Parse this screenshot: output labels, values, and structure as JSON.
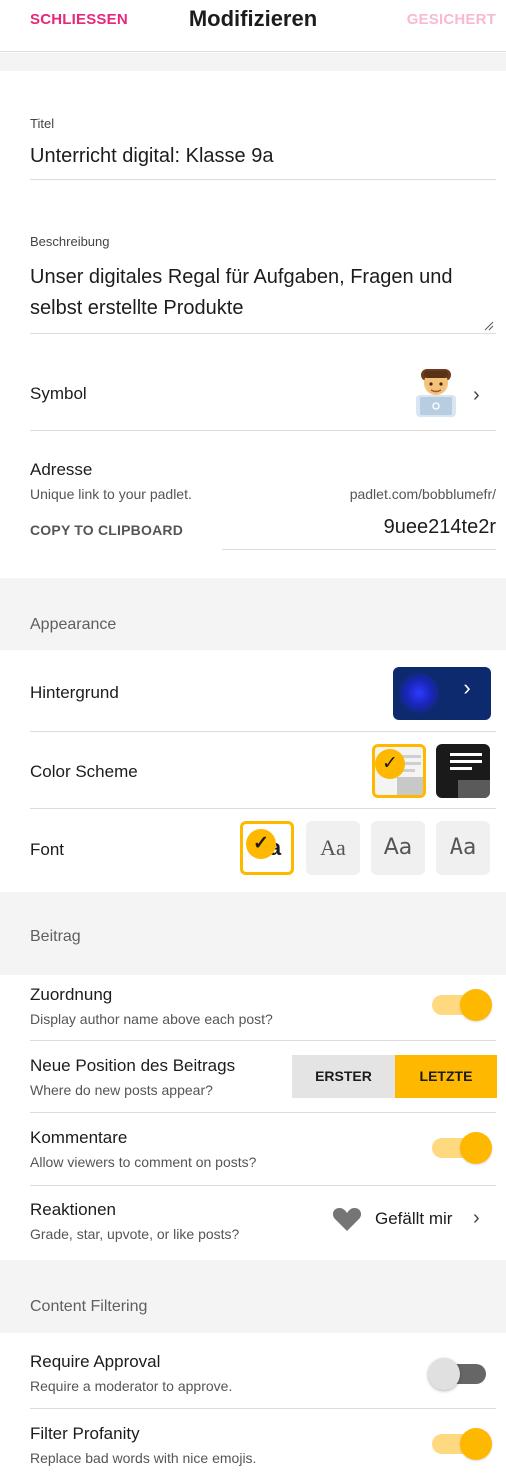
{
  "header": {
    "close_label": "SCHLIESSEN",
    "title": "Modifizieren",
    "save_label": "GESICHERT"
  },
  "form": {
    "title_label": "Titel",
    "title_value": "Unterricht digital: Klasse 9a",
    "description_label": "Beschreibung",
    "description_line1": "Unser digitales Regal für Aufgaben, Fragen und",
    "description_line2": "selbst erstellte Produkte",
    "symbol_label": "Symbol",
    "address_label": "Adresse",
    "address_hint": "Unique link to your padlet.",
    "address_base": "padlet.com/bobblumefr/",
    "copy_label": "COPY TO CLIPBOARD",
    "address_slug": "9uee214te2r"
  },
  "appearance": {
    "section_label": "Appearance",
    "background_label": "Hintergrund",
    "color_scheme_label": "Color Scheme",
    "font_label": "Font",
    "fonts": [
      "Aa",
      "Aa",
      "Aa",
      "Aa"
    ]
  },
  "post": {
    "section_label": "Beitrag",
    "attribution_label": "Zuordnung",
    "attribution_desc": "Display author name above each post?",
    "attribution_on": true,
    "position_label": "Neue Position des Beitrags",
    "position_desc": "Where do new posts appear?",
    "position_first": "ERSTER",
    "position_last": "LETZTE",
    "comments_label": "Kommentare",
    "comments_desc": "Allow viewers to comment on posts?",
    "comments_on": true,
    "reactions_label": "Reaktionen",
    "reactions_desc": "Grade, star, upvote, or like posts?",
    "reactions_value": "Gefällt mir"
  },
  "filtering": {
    "section_label": "Content Filtering",
    "approval_label": "Require Approval",
    "approval_desc": "Require a moderator to approve.",
    "approval_on": false,
    "profanity_label": "Filter Profanity",
    "profanity_desc": "Replace bad words with nice emojis.",
    "profanity_on": true
  },
  "icons": {
    "chevron": "chevron-right-icon",
    "check": "check-icon",
    "heart": "heart-icon",
    "symbol": "person-laptop-emoji"
  },
  "colors": {
    "accent": "#ffb800",
    "close": "#e8277a",
    "save_disabled": "#f7b9d3",
    "background_tile": "#0e2a6e"
  }
}
